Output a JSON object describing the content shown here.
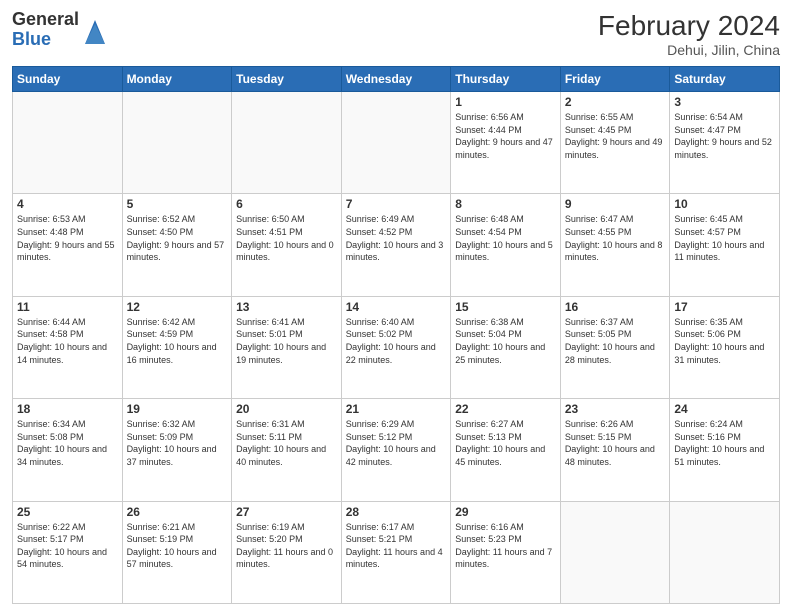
{
  "header": {
    "logo_general": "General",
    "logo_blue": "Blue",
    "month_title": "February 2024",
    "location": "Dehui, Jilin, China"
  },
  "weekdays": [
    "Sunday",
    "Monday",
    "Tuesday",
    "Wednesday",
    "Thursday",
    "Friday",
    "Saturday"
  ],
  "rows": [
    [
      {
        "day": "",
        "info": ""
      },
      {
        "day": "",
        "info": ""
      },
      {
        "day": "",
        "info": ""
      },
      {
        "day": "",
        "info": ""
      },
      {
        "day": "1",
        "info": "Sunrise: 6:56 AM\nSunset: 4:44 PM\nDaylight: 9 hours and 47 minutes."
      },
      {
        "day": "2",
        "info": "Sunrise: 6:55 AM\nSunset: 4:45 PM\nDaylight: 9 hours and 49 minutes."
      },
      {
        "day": "3",
        "info": "Sunrise: 6:54 AM\nSunset: 4:47 PM\nDaylight: 9 hours and 52 minutes."
      }
    ],
    [
      {
        "day": "4",
        "info": "Sunrise: 6:53 AM\nSunset: 4:48 PM\nDaylight: 9 hours and 55 minutes."
      },
      {
        "day": "5",
        "info": "Sunrise: 6:52 AM\nSunset: 4:50 PM\nDaylight: 9 hours and 57 minutes."
      },
      {
        "day": "6",
        "info": "Sunrise: 6:50 AM\nSunset: 4:51 PM\nDaylight: 10 hours and 0 minutes."
      },
      {
        "day": "7",
        "info": "Sunrise: 6:49 AM\nSunset: 4:52 PM\nDaylight: 10 hours and 3 minutes."
      },
      {
        "day": "8",
        "info": "Sunrise: 6:48 AM\nSunset: 4:54 PM\nDaylight: 10 hours and 5 minutes."
      },
      {
        "day": "9",
        "info": "Sunrise: 6:47 AM\nSunset: 4:55 PM\nDaylight: 10 hours and 8 minutes."
      },
      {
        "day": "10",
        "info": "Sunrise: 6:45 AM\nSunset: 4:57 PM\nDaylight: 10 hours and 11 minutes."
      }
    ],
    [
      {
        "day": "11",
        "info": "Sunrise: 6:44 AM\nSunset: 4:58 PM\nDaylight: 10 hours and 14 minutes."
      },
      {
        "day": "12",
        "info": "Sunrise: 6:42 AM\nSunset: 4:59 PM\nDaylight: 10 hours and 16 minutes."
      },
      {
        "day": "13",
        "info": "Sunrise: 6:41 AM\nSunset: 5:01 PM\nDaylight: 10 hours and 19 minutes."
      },
      {
        "day": "14",
        "info": "Sunrise: 6:40 AM\nSunset: 5:02 PM\nDaylight: 10 hours and 22 minutes."
      },
      {
        "day": "15",
        "info": "Sunrise: 6:38 AM\nSunset: 5:04 PM\nDaylight: 10 hours and 25 minutes."
      },
      {
        "day": "16",
        "info": "Sunrise: 6:37 AM\nSunset: 5:05 PM\nDaylight: 10 hours and 28 minutes."
      },
      {
        "day": "17",
        "info": "Sunrise: 6:35 AM\nSunset: 5:06 PM\nDaylight: 10 hours and 31 minutes."
      }
    ],
    [
      {
        "day": "18",
        "info": "Sunrise: 6:34 AM\nSunset: 5:08 PM\nDaylight: 10 hours and 34 minutes."
      },
      {
        "day": "19",
        "info": "Sunrise: 6:32 AM\nSunset: 5:09 PM\nDaylight: 10 hours and 37 minutes."
      },
      {
        "day": "20",
        "info": "Sunrise: 6:31 AM\nSunset: 5:11 PM\nDaylight: 10 hours and 40 minutes."
      },
      {
        "day": "21",
        "info": "Sunrise: 6:29 AM\nSunset: 5:12 PM\nDaylight: 10 hours and 42 minutes."
      },
      {
        "day": "22",
        "info": "Sunrise: 6:27 AM\nSunset: 5:13 PM\nDaylight: 10 hours and 45 minutes."
      },
      {
        "day": "23",
        "info": "Sunrise: 6:26 AM\nSunset: 5:15 PM\nDaylight: 10 hours and 48 minutes."
      },
      {
        "day": "24",
        "info": "Sunrise: 6:24 AM\nSunset: 5:16 PM\nDaylight: 10 hours and 51 minutes."
      }
    ],
    [
      {
        "day": "25",
        "info": "Sunrise: 6:22 AM\nSunset: 5:17 PM\nDaylight: 10 hours and 54 minutes."
      },
      {
        "day": "26",
        "info": "Sunrise: 6:21 AM\nSunset: 5:19 PM\nDaylight: 10 hours and 57 minutes."
      },
      {
        "day": "27",
        "info": "Sunrise: 6:19 AM\nSunset: 5:20 PM\nDaylight: 11 hours and 0 minutes."
      },
      {
        "day": "28",
        "info": "Sunrise: 6:17 AM\nSunset: 5:21 PM\nDaylight: 11 hours and 4 minutes."
      },
      {
        "day": "29",
        "info": "Sunrise: 6:16 AM\nSunset: 5:23 PM\nDaylight: 11 hours and 7 minutes."
      },
      {
        "day": "",
        "info": ""
      },
      {
        "day": "",
        "info": ""
      }
    ]
  ]
}
